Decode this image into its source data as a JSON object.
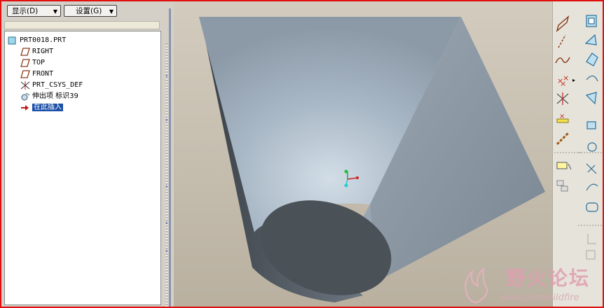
{
  "menus": {
    "display_label": "显示(D)",
    "settings_label": "设置(G)"
  },
  "tree": {
    "items": [
      {
        "label": "PRT0018.PRT",
        "icon": "part-icon"
      },
      {
        "label": "RIGHT",
        "icon": "datum-plane-icon"
      },
      {
        "label": "TOP",
        "icon": "datum-plane-icon"
      },
      {
        "label": "FRONT",
        "icon": "datum-plane-icon"
      },
      {
        "label": "PRT_CSYS_DEF",
        "icon": "coordinate-system-icon"
      },
      {
        "label": "伸出项 标识39",
        "icon": "protrusion-icon"
      },
      {
        "label": "在此插入",
        "icon": "insert-here-arrow-icon"
      }
    ]
  },
  "watermark": {
    "title": "野火论坛",
    "url": "www.proewildfire"
  },
  "colors": {
    "window_border": "#e01010",
    "viewport_bg": "#c2b9a8",
    "selection": "#1c4fa8",
    "watermark_text": "#e0a0b0"
  }
}
